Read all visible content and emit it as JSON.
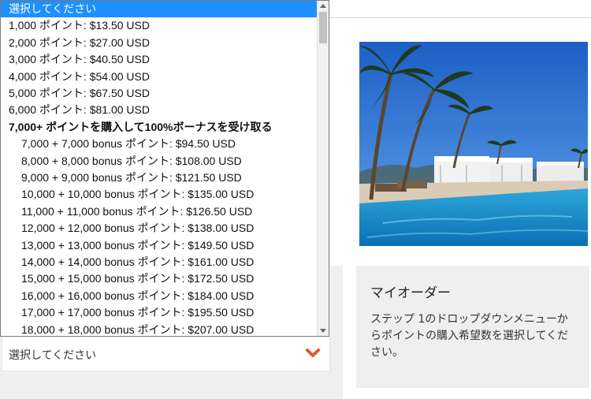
{
  "select": {
    "value": "選択してください",
    "accent_color": "#e8542b"
  },
  "dropdown": {
    "selected_color": "#1e90ff",
    "options": [
      {
        "label": "選択してください",
        "level": 0,
        "selected": true,
        "group": false
      },
      {
        "label": "1,000 ポイント: $13.50 USD",
        "level": 0,
        "selected": false,
        "group": false
      },
      {
        "label": "2,000 ポイント: $27.00 USD",
        "level": 0,
        "selected": false,
        "group": false
      },
      {
        "label": "3,000 ポイント: $40.50 USD",
        "level": 0,
        "selected": false,
        "group": false
      },
      {
        "label": "4,000 ポイント: $54.00 USD",
        "level": 0,
        "selected": false,
        "group": false
      },
      {
        "label": "5,000 ポイント: $67.50 USD",
        "level": 0,
        "selected": false,
        "group": false
      },
      {
        "label": "6,000 ポイント: $81.00 USD",
        "level": 0,
        "selected": false,
        "group": false
      },
      {
        "label": "7,000+ ポイントを購入して100%ボーナスを受け取る",
        "level": 0,
        "selected": false,
        "group": true
      },
      {
        "label": "7,000 + 7,000 bonus ポイント: $94.50 USD",
        "level": 1,
        "selected": false,
        "group": false
      },
      {
        "label": "8,000 + 8,000 bonus ポイント: $108.00 USD",
        "level": 1,
        "selected": false,
        "group": false
      },
      {
        "label": "9,000 + 9,000 bonus ポイント: $121.50 USD",
        "level": 1,
        "selected": false,
        "group": false
      },
      {
        "label": "10,000 + 10,000 bonus ポイント: $135.00 USD",
        "level": 1,
        "selected": false,
        "group": false
      },
      {
        "label": "11,000 + 11,000 bonus ポイント: $126.50 USD",
        "level": 1,
        "selected": false,
        "group": false
      },
      {
        "label": "12,000 + 12,000 bonus ポイント: $138.00 USD",
        "level": 1,
        "selected": false,
        "group": false
      },
      {
        "label": "13,000 + 13,000 bonus ポイント: $149.50 USD",
        "level": 1,
        "selected": false,
        "group": false
      },
      {
        "label": "14,000 + 14,000 bonus ポイント: $161.00 USD",
        "level": 1,
        "selected": false,
        "group": false
      },
      {
        "label": "15,000 + 15,000 bonus ポイント: $172.50 USD",
        "level": 1,
        "selected": false,
        "group": false
      },
      {
        "label": "16,000 + 16,000 bonus ポイント: $184.00 USD",
        "level": 1,
        "selected": false,
        "group": false
      },
      {
        "label": "17,000 + 17,000 bonus ポイント: $195.50 USD",
        "level": 1,
        "selected": false,
        "group": false
      },
      {
        "label": "18,000 + 18,000 bonus ポイント: $207.00 USD",
        "level": 1,
        "selected": false,
        "group": false
      }
    ]
  },
  "order": {
    "title": "マイオーダー",
    "text": "ステップ 1のドロップダウンメニューからポイントの購入希望数を選択してください。"
  }
}
